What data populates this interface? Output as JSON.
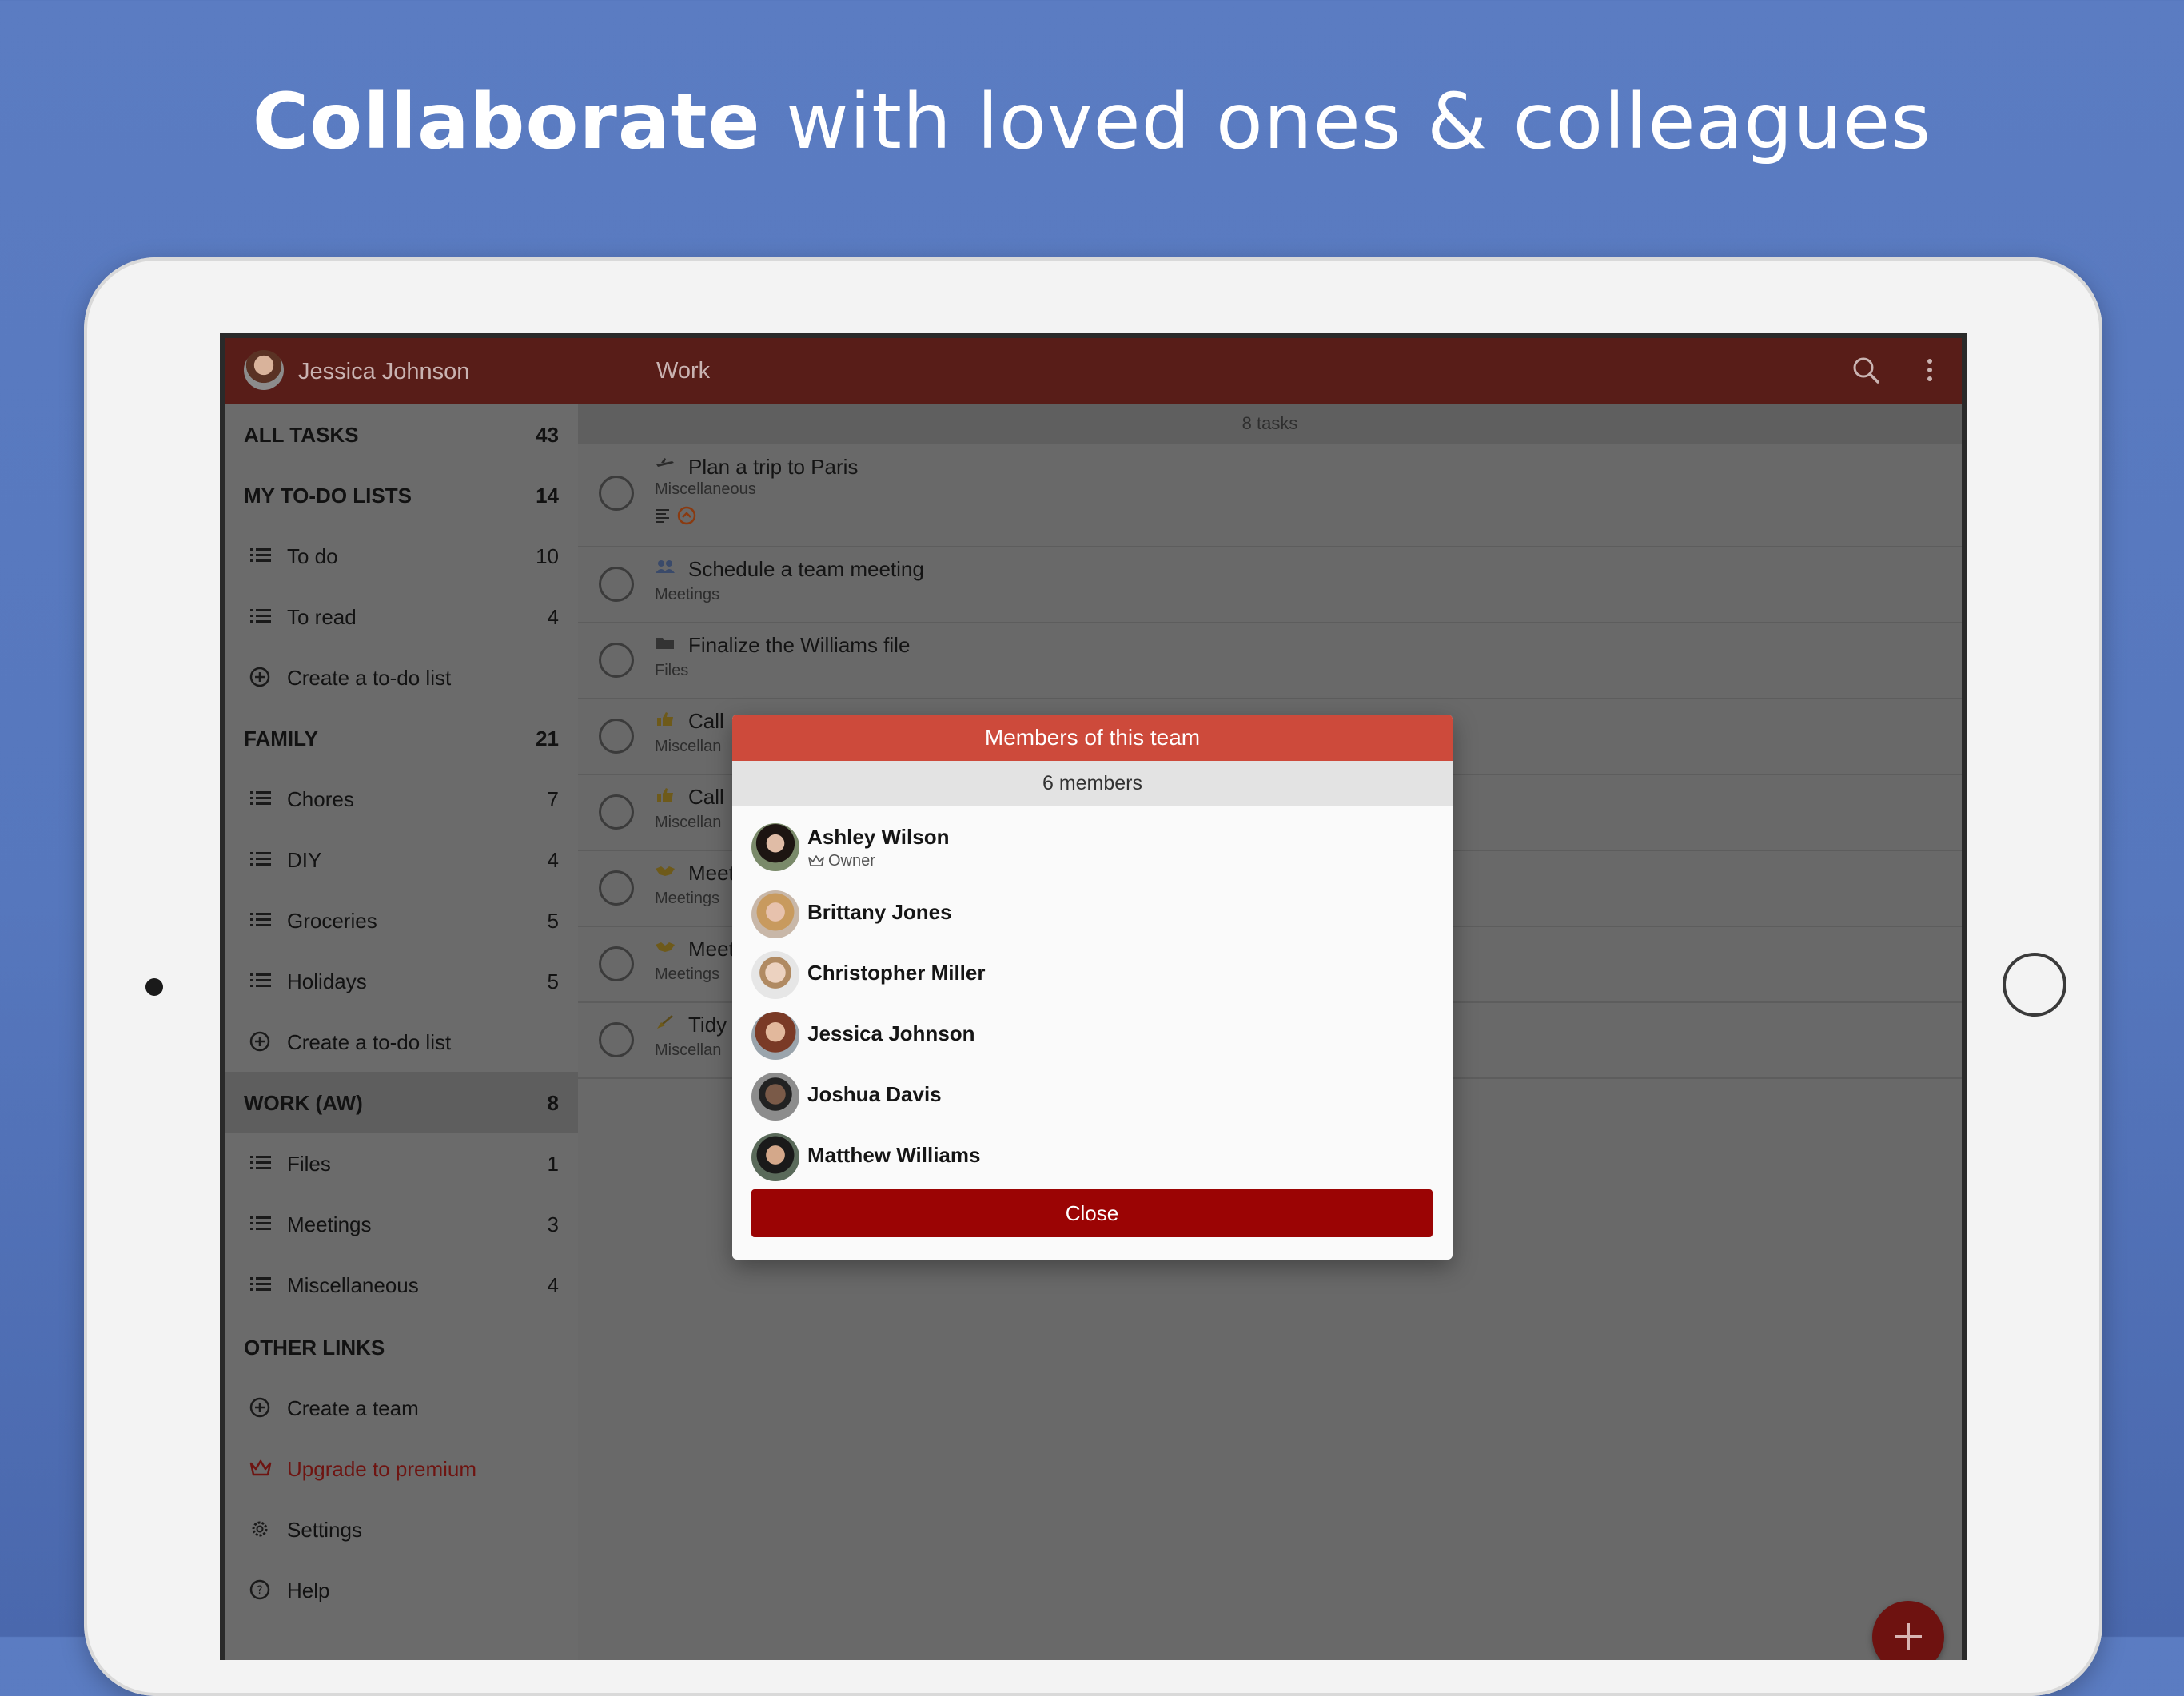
{
  "headline": {
    "bold": "Collaborate",
    "rest": " with loved ones & colleagues"
  },
  "topbar": {
    "user_name": "Jessica Johnson",
    "section_title": "Work",
    "search_icon": "search-icon",
    "more_icon": "more-vert-icon"
  },
  "sidebar": {
    "all_tasks": {
      "label": "ALL TASKS",
      "count": "43"
    },
    "my_lists": {
      "label": "MY TO-DO LISTS",
      "count": "14",
      "items": [
        {
          "label": "To do",
          "count": "10"
        },
        {
          "label": "To read",
          "count": "4"
        }
      ],
      "create": "Create a to-do list"
    },
    "family": {
      "label": "FAMILY",
      "count": "21",
      "items": [
        {
          "label": "Chores",
          "count": "7"
        },
        {
          "label": "DIY",
          "count": "4"
        },
        {
          "label": "Groceries",
          "count": "5"
        },
        {
          "label": "Holidays",
          "count": "5"
        }
      ],
      "create": "Create a to-do list"
    },
    "work": {
      "label": "WORK (AW)",
      "count": "8",
      "items": [
        {
          "label": "Files",
          "count": "1"
        },
        {
          "label": "Meetings",
          "count": "3"
        },
        {
          "label": "Miscellaneous",
          "count": "4"
        }
      ]
    },
    "other": {
      "label": "OTHER LINKS",
      "create_team": "Create a team",
      "premium": "Upgrade to premium",
      "settings": "Settings",
      "help": "Help"
    }
  },
  "main": {
    "task_count": "8 tasks",
    "tasks": [
      {
        "title": "Plan a trip to Paris",
        "sub": "Miscellaneous"
      },
      {
        "title": "Schedule a team meeting",
        "sub": "Meetings"
      },
      {
        "title": "Finalize the Williams file",
        "sub": "Files"
      },
      {
        "title": "Call",
        "sub": "Miscellan"
      },
      {
        "title": "Call",
        "sub": "Miscellan"
      },
      {
        "title": "Meet",
        "sub": "Meetings"
      },
      {
        "title": "Meet",
        "sub": "Meetings"
      },
      {
        "title": "Tidy",
        "sub": "Miscellan"
      }
    ]
  },
  "dialog": {
    "title": "Members of this team",
    "count": "6 members",
    "members": [
      {
        "name": "Ashley Wilson",
        "role": "Owner"
      },
      {
        "name": "Brittany Jones"
      },
      {
        "name": "Christopher Miller"
      },
      {
        "name": "Jessica Johnson"
      },
      {
        "name": "Joshua Davis"
      },
      {
        "name": "Matthew Williams"
      }
    ],
    "close_label": "Close"
  },
  "colors": {
    "background": "#5b7cc2",
    "topbar": "#581d18",
    "dialog_header": "#cd4a3b",
    "close_button": "#9b0404",
    "fab": "#6e1210"
  }
}
